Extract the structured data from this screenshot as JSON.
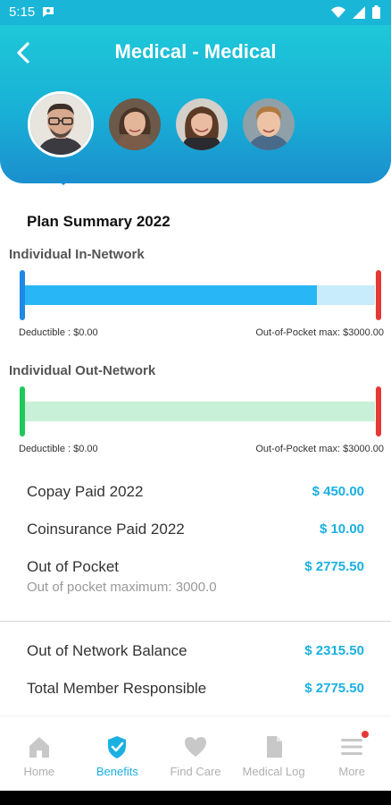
{
  "status_bar": {
    "time": "5:15"
  },
  "header": {
    "title": "Medical - Medical"
  },
  "members": [
    {
      "name_icon": "avatar-adult-male"
    },
    {
      "name_icon": "avatar-adult-female"
    },
    {
      "name_icon": "avatar-adult-female"
    },
    {
      "name_icon": "avatar-child-male"
    }
  ],
  "plan_summary": {
    "title": "Plan Summary 2022",
    "in_network": {
      "label": "Individual In-Network",
      "deductible": "Deductible : $0.00",
      "oop_max": "Out-of-Pocket max: $3000.00",
      "fill_fraction": 0.835,
      "fill_color": "#29b6f6",
      "track_color": "#c8ecfb",
      "start_color": "#1e88e5",
      "end_color": "#e53935"
    },
    "out_network": {
      "label": "Individual Out-Network",
      "deductible": "Deductible : $0.00",
      "oop_max": "Out-of-Pocket max: $3000.00",
      "fill_fraction": 1.0,
      "fill_color": "#c8f0d8",
      "track_color": "#c8f0d8",
      "start_color": "#1ec95a",
      "end_color": "#e53935"
    }
  },
  "amounts": {
    "copay_label": "Copay Paid 2022",
    "copay_value": "$ 450.00",
    "coins_label": "Coinsurance Paid 2022",
    "coins_value": "$ 10.00",
    "oop_label": "Out of Pocket",
    "oop_value": "$ 2775.50",
    "oop_max_label": "Out of pocket maximum: 3000.0",
    "oon_label": "Out of Network Balance",
    "oon_value": "$ 2315.50",
    "total_label": "Total Member Responsible",
    "total_value": "$ 2775.50"
  },
  "bottom_nav": [
    {
      "label": "Home",
      "icon": "home-icon"
    },
    {
      "label": "Benefits",
      "icon": "shield-check-icon",
      "active": true
    },
    {
      "label": "Find Care",
      "icon": "heart-icon"
    },
    {
      "label": "Medical Log",
      "icon": "document-icon"
    },
    {
      "label": "More",
      "icon": "menu-icon",
      "badge": true
    }
  ],
  "colors": {
    "accent": "#1ab0e2",
    "header_top": "#1ec8d8",
    "header_bottom": "#1a8fce"
  }
}
